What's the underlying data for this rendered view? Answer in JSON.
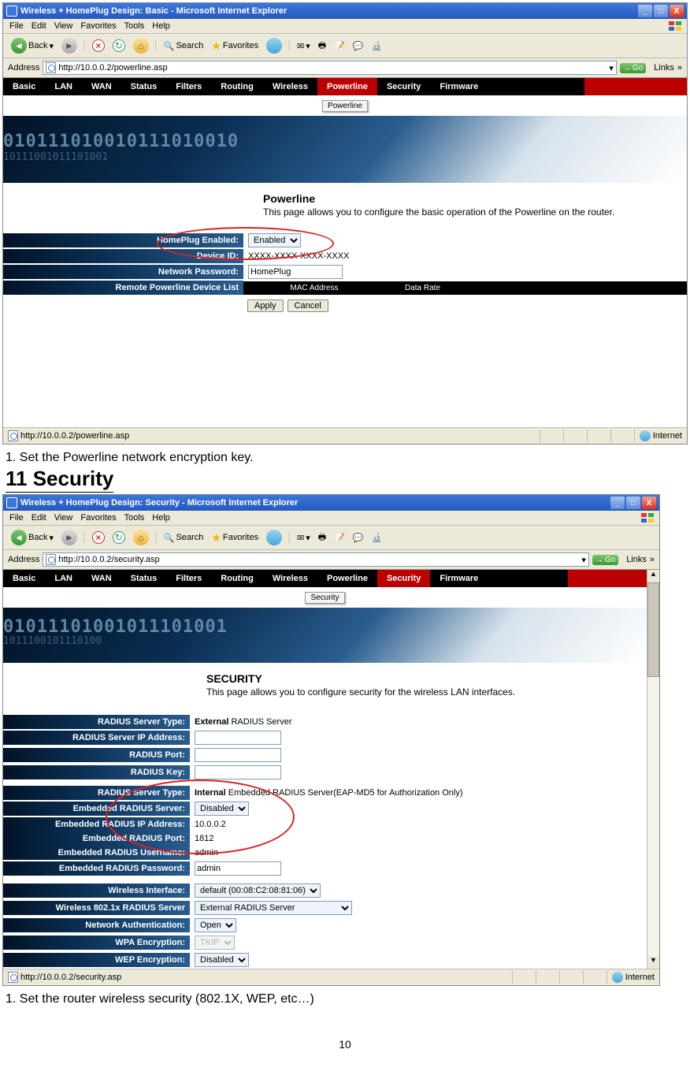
{
  "shot1": {
    "title": "Wireless + HomePlug Design: Basic - Microsoft Internet Explorer",
    "menu": [
      "File",
      "Edit",
      "View",
      "Favorites",
      "Tools",
      "Help"
    ],
    "tb": {
      "back": "Back",
      "search": "Search",
      "favorites": "Favorites"
    },
    "addr": {
      "label": "Address",
      "url": "http://10.0.0.2/powerline.asp",
      "go": "Go",
      "links": "Links"
    },
    "tabs": [
      "Basic",
      "LAN",
      "WAN",
      "Status",
      "Filters",
      "Routing",
      "Wireless",
      "Powerline",
      "Security",
      "Firmware"
    ],
    "activeTab": "Powerline",
    "submenu": "Powerline",
    "desc": {
      "h": "Powerline",
      "p": "This page allows you to configure the basic operation of the Powerline on the router."
    },
    "rows": {
      "r1": {
        "lab": "HomePlug Enabled:",
        "opt": "Enabled"
      },
      "r2": {
        "lab": "Device ID:",
        "val": "XXXX-XXXX-XXXX-XXXX"
      },
      "r3": {
        "lab": "Network Password:",
        "val": "HomePlug"
      },
      "r4": {
        "lab": "Remote Powerline Device List",
        "c1": "MAC Address",
        "c2": "Data Rate"
      }
    },
    "btns": {
      "apply": "Apply",
      "cancel": "Cancel"
    },
    "status": {
      "url": "http://10.0.0.2/powerline.asp",
      "zone": "Internet"
    }
  },
  "step1": "1. Set the Powerline network encryption key.",
  "secHead": "11 Security",
  "shot2": {
    "title": "Wireless + HomePlug Design: Security - Microsoft Internet Explorer",
    "menu": [
      "File",
      "Edit",
      "View",
      "Favorites",
      "Tools",
      "Help"
    ],
    "tb": {
      "back": "Back",
      "search": "Search",
      "favorites": "Favorites"
    },
    "addr": {
      "label": "Address",
      "url": "http://10.0.0.2/security.asp",
      "go": "Go",
      "links": "Links"
    },
    "tabs": [
      "Basic",
      "LAN",
      "WAN",
      "Status",
      "Filters",
      "Routing",
      "Wireless",
      "Powerline",
      "Security",
      "Firmware"
    ],
    "activeTab": "Security",
    "submenu": "Security",
    "desc": {
      "h": "SECURITY",
      "p": "This page allows you to configure security for the wireless LAN interfaces."
    },
    "g1": {
      "r1": {
        "lab": "RADIUS Server Type:",
        "val": "External RADIUS Server"
      },
      "r2": {
        "lab": "RADIUS Server IP Address:",
        "val": ""
      },
      "r3": {
        "lab": "RADIUS Port:",
        "val": ""
      },
      "r4": {
        "lab": "RADIUS Key:",
        "val": ""
      }
    },
    "g2": {
      "r1": {
        "lab": "RADIUS Server Type:",
        "val": "Internal Embedded RADIUS Server(EAP-MD5 for Authorization Only)"
      },
      "r2": {
        "lab": "Embedded RADIUS Server:",
        "opt": "Disabled"
      },
      "r3": {
        "lab": "Embedded RADIUS IP Address:",
        "val": "10.0.0.2"
      },
      "r4": {
        "lab": "Embedded RADIUS Port:",
        "val": "1812"
      },
      "r5": {
        "lab": "Embedded RADIUS Username:",
        "val": "admin"
      },
      "r6": {
        "lab": "Embedded RADIUS Password:",
        "val": "admin"
      }
    },
    "g3": {
      "r1": {
        "lab": "Wireless Interface:",
        "opt": "default (00:08:C2:08:81:06)"
      },
      "r2": {
        "lab": "Wireless 802.1x RADIUS Server",
        "opt": "External RADIUS Server"
      },
      "r3": {
        "lab": "Network Authentication:",
        "opt": "Open"
      },
      "r4": {
        "lab": "WPA Encryption:",
        "opt": "TKIP"
      },
      "r5": {
        "lab": "WEP Encryption:",
        "opt": "Disabled"
      }
    },
    "status": {
      "url": "http://10.0.0.2/security.asp",
      "zone": "Internet"
    }
  },
  "step2": "1. Set the router wireless security (802.1X, WEP, etc…)",
  "pageNum": "10"
}
